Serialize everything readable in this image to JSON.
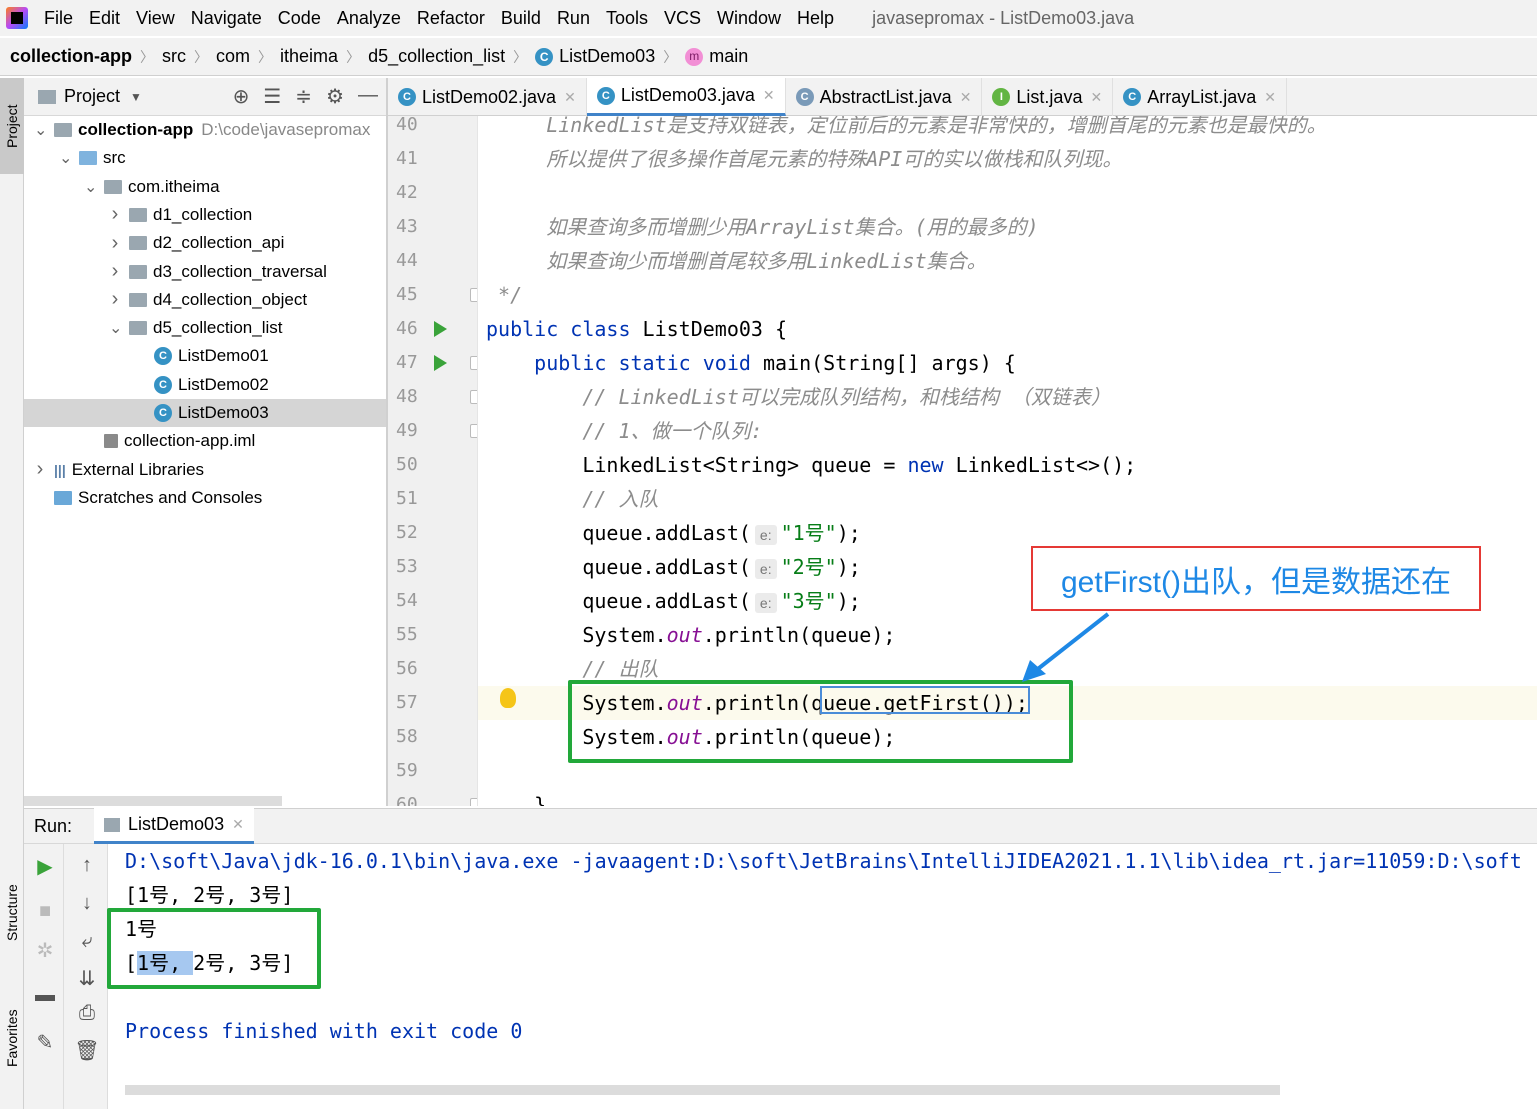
{
  "menu": {
    "items": [
      "File",
      "Edit",
      "View",
      "Navigate",
      "Code",
      "Analyze",
      "Refactor",
      "Build",
      "Run",
      "Tools",
      "VCS",
      "Window",
      "Help"
    ],
    "title": "javasepromax - ListDemo03.java"
  },
  "breadcrumb": {
    "project": "collection-app",
    "items": [
      "src",
      "com",
      "itheima",
      "d5_collection_list",
      "ListDemo03",
      "main"
    ]
  },
  "sidebar": {
    "left_tab": "Project",
    "structure_tab": "Structure",
    "favorites_tab": "Favorites"
  },
  "project_panel": {
    "title": "Project"
  },
  "tree": [
    {
      "label": "collection-app",
      "extra": "D:\\code\\javasepromax",
      "indent": 0,
      "arrow": "v",
      "type": "module",
      "bold": true
    },
    {
      "label": "src",
      "indent": 1,
      "arrow": "v",
      "type": "src"
    },
    {
      "label": "com.itheima",
      "indent": 2,
      "arrow": "v",
      "type": "pkg"
    },
    {
      "label": "d1_collection",
      "indent": 3,
      "arrow": ">",
      "type": "pkg"
    },
    {
      "label": "d2_collection_api",
      "indent": 3,
      "arrow": ">",
      "type": "pkg"
    },
    {
      "label": "d3_collection_traversal",
      "indent": 3,
      "arrow": ">",
      "type": "pkg"
    },
    {
      "label": "d4_collection_object",
      "indent": 3,
      "arrow": ">",
      "type": "pkg"
    },
    {
      "label": "d5_collection_list",
      "indent": 3,
      "arrow": "v",
      "type": "pkg"
    },
    {
      "label": "ListDemo01",
      "indent": 4,
      "arrow": "",
      "type": "class"
    },
    {
      "label": "ListDemo02",
      "indent": 4,
      "arrow": "",
      "type": "class"
    },
    {
      "label": "ListDemo03",
      "indent": 4,
      "arrow": "",
      "type": "class",
      "selected": true
    },
    {
      "label": "collection-app.iml",
      "indent": 2,
      "arrow": "",
      "type": "iml"
    },
    {
      "label": "External Libraries",
      "indent": 0,
      "arrow": ">",
      "type": "lib"
    },
    {
      "label": "Scratches and Consoles",
      "indent": 0,
      "arrow": "",
      "type": "scratch"
    }
  ],
  "tabs": [
    {
      "label": "ListDemo02.java",
      "icon": "C",
      "color": "#3592c4"
    },
    {
      "label": "ListDemo03.java",
      "icon": "C",
      "color": "#3592c4",
      "active": true
    },
    {
      "label": "AbstractList.java",
      "icon": "C",
      "color": "#7a9ab8"
    },
    {
      "label": "List.java",
      "icon": "I",
      "color": "#62b543"
    },
    {
      "label": "ArrayList.java",
      "icon": "C",
      "color": "#3592c4"
    }
  ],
  "line_numbers": [
    "40",
    "41",
    "42",
    "43",
    "44",
    "45",
    "46",
    "47",
    "48",
    "49",
    "50",
    "51",
    "52",
    "53",
    "54",
    "55",
    "56",
    "57",
    "58",
    "59",
    "60"
  ],
  "code": [
    {
      "parts": [
        [
          "     LinkedList是支持双链表，定位前后的元素是非常快的，增删首尾的元素也是最快的。",
          "cmt"
        ]
      ]
    },
    {
      "parts": [
        [
          "     所以提供了很多操作首尾元素的特殊API可的实以做栈和队列现。",
          "cmt"
        ]
      ]
    },
    {
      "parts": [
        [
          "",
          ""
        ]
      ]
    },
    {
      "parts": [
        [
          "     如果查询多而增删少用ArrayList集合。(用的最多的)",
          "cmt"
        ]
      ]
    },
    {
      "parts": [
        [
          "     如果查询少而增删首尾较多用LinkedList集合。",
          "cmt"
        ]
      ]
    },
    {
      "parts": [
        [
          " */",
          "cmt"
        ]
      ]
    },
    {
      "parts": [
        [
          "public class ",
          "kw"
        ],
        [
          "ListDemo03 {",
          ""
        ]
      ]
    },
    {
      "parts": [
        [
          "    public static void ",
          "kw"
        ],
        [
          "main(String[] args) {",
          ""
        ]
      ]
    },
    {
      "parts": [
        [
          "        // LinkedList可以完成队列结构，和栈结构 （双链表）",
          "cmt"
        ]
      ]
    },
    {
      "parts": [
        [
          "        // 1、做一个队列:",
          "cmt"
        ]
      ]
    },
    {
      "parts": [
        [
          "        LinkedList<String> queue = ",
          ""
        ],
        [
          "new ",
          "kw"
        ],
        [
          "LinkedList<>();",
          ""
        ]
      ]
    },
    {
      "parts": [
        [
          "        // 入队",
          "cmt"
        ]
      ]
    },
    {
      "parts": [
        [
          "        queue.addLast(",
          ""
        ],
        [
          "e:",
          "hint"
        ],
        [
          "\"1号\"",
          "str"
        ],
        [
          ");",
          ""
        ]
      ]
    },
    {
      "parts": [
        [
          "        queue.addLast(",
          ""
        ],
        [
          "e:",
          "hint"
        ],
        [
          "\"2号\"",
          "str"
        ],
        [
          ");",
          ""
        ]
      ]
    },
    {
      "parts": [
        [
          "        queue.addLast(",
          ""
        ],
        [
          "e:",
          "hint"
        ],
        [
          "\"3号\"",
          "str"
        ],
        [
          ");",
          ""
        ]
      ]
    },
    {
      "parts": [
        [
          "        System.",
          ""
        ],
        [
          "out",
          "fld"
        ],
        [
          ".println(queue);",
          ""
        ]
      ]
    },
    {
      "parts": [
        [
          "        // 出队",
          "cmt"
        ]
      ]
    },
    {
      "parts": [
        [
          "        System.",
          ""
        ],
        [
          "out",
          "fld"
        ],
        [
          ".println(queue.getFirst());",
          ""
        ]
      ],
      "hl": true
    },
    {
      "parts": [
        [
          "        System.",
          ""
        ],
        [
          "out",
          "fld"
        ],
        [
          ".println(queue);",
          ""
        ]
      ]
    },
    {
      "parts": [
        [
          "",
          ""
        ]
      ]
    },
    {
      "parts": [
        [
          "    }",
          ""
        ]
      ]
    }
  ],
  "annotation": {
    "text": "getFirst()出队，但是数据还在",
    "arrow_color": "#1e88e5"
  },
  "run": {
    "label": "Run:",
    "tab": "ListDemo03"
  },
  "console": [
    {
      "text": "D:\\soft\\Java\\jdk-16.0.1\\bin\\java.exe -javaagent:D:\\soft\\JetBrains\\IntelliJIDEA2021.1.1\\lib\\idea_rt.jar=11059:D:\\soft",
      "kind": "cmd"
    },
    {
      "text": "[1号, 2号, 3号]",
      "kind": "out"
    },
    {
      "text": "1号",
      "kind": "out"
    },
    {
      "text": "[1号, 2号, 3号]",
      "kind": "out",
      "selected": "1号, "
    },
    {
      "text": "",
      "kind": "out"
    },
    {
      "text": "Process finished with exit code 0",
      "kind": "fin"
    }
  ]
}
